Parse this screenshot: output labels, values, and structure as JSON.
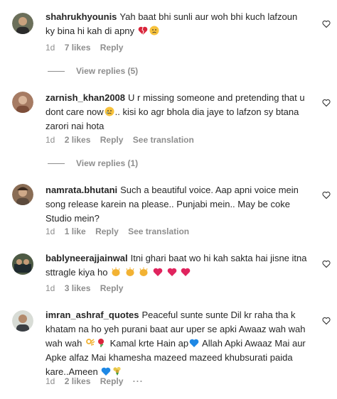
{
  "comments": [
    {
      "username": "shahrukhyounis",
      "text": "Yah baat bhi sunli aur woh bhi kuch lafzoun ky bina hi kah di apny",
      "time": "1d",
      "likes": "7 likes",
      "reply": "Reply",
      "view_replies": "View replies (5)"
    },
    {
      "username": "zarnish_khan2008",
      "text_a": "U r missing someone and pretending that u dont care now",
      "text_b": ".. kisi ko agr bhola dia jaye to lafzon sy btana zarori nai hota",
      "time": "1d",
      "likes": "2 likes",
      "reply": "Reply",
      "see_translation": "See translation",
      "view_replies": "View replies (1)"
    },
    {
      "username": "namrata.bhutani",
      "text": "Such a beautiful voice. Aap apni voice mein song release karein na please.. Punjabi mein.. May be coke Studio mein?",
      "time": "1d",
      "likes": "1 like",
      "reply": "Reply",
      "see_translation": "See translation"
    },
    {
      "username": "bablyneerajjainwal",
      "text": "Itni ghari baat wo hi kah sakta hai jisne itna sttragle kiya ho",
      "time": "1d",
      "likes": "3 likes",
      "reply": "Reply"
    },
    {
      "username": "imran_ashraf_quotes",
      "text_a": "Peaceful sunte sunte Dil kr raha tha k khatam na ho yeh purani baat aur uper se apki Awaaz wah wah wah wah",
      "text_b": "Kamal krte Hain ap",
      "text_c": "Allah Apki Awaaz Mai aur Apke alfaz Mai khamesha mazeed mazeed khubsurati paida kare..Ameen",
      "time": "1d",
      "likes": "2 likes",
      "reply": "Reply"
    }
  ],
  "colors": {
    "text": "#262626",
    "muted": "#8e8e8e",
    "heart_red": "#e0245e",
    "heart_blue": "#1e88e5"
  }
}
